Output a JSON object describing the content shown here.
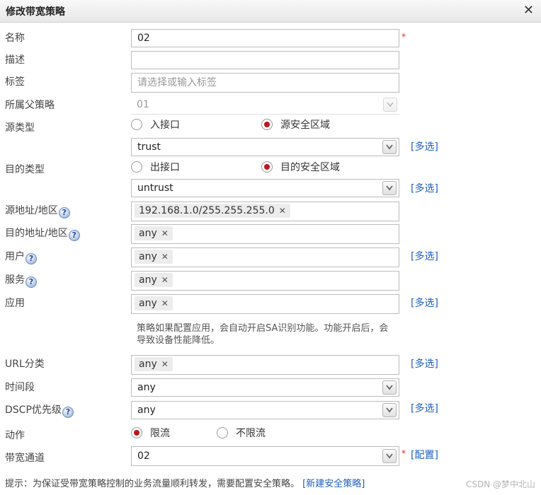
{
  "dialog": {
    "title": "修改带宽策略",
    "close_glyph": "✕"
  },
  "labels": {
    "name": "名称",
    "desc": "描述",
    "tag": "标签",
    "parent": "所属父策略",
    "src_type": "源类型",
    "dst_type": "目的类型",
    "src_addr": "源地址/地区",
    "dst_addr": "目的地址/地区",
    "user": "用户",
    "service": "服务",
    "app": "应用",
    "url": "URL分类",
    "schedule": "时间段",
    "dscp": "DSCP优先级",
    "action": "动作",
    "channel": "带宽通道"
  },
  "fields": {
    "name_value": "02",
    "desc_value": "",
    "tag_placeholder": "请选择或输入标签",
    "parent_value": "01",
    "src_zone_value": "trust",
    "dst_zone_value": "untrust",
    "src_addr_tag": "192.168.1.0/255.255.255.0",
    "dst_addr_tag": "any",
    "user_tag": "any",
    "service_tag": "any",
    "app_tag": "any",
    "url_tag": "any",
    "schedule_value": "any",
    "dscp_value": "any",
    "channel_value": "02"
  },
  "radios": {
    "src_in_if": "入接口",
    "src_zone": "源安全区域",
    "dst_out_if": "出接口",
    "dst_zone": "目的安全区域",
    "limit": "限流",
    "no_limit": "不限流"
  },
  "links": {
    "multi": "[多选]",
    "config": "[配置]",
    "new_policy": "[新建安全策略]"
  },
  "texts": {
    "required_mark": "*",
    "help_mark": "?",
    "tag_remove": "✕",
    "app_note": "策略如果配置应用，会自动开启SA识别功能。功能开启后，会导致设备性能降低。",
    "footer_tip": "提示：为保证受带宽策略控制的业务流量顺利转发，需要配置安全策略。",
    "watermark": "CSDN @梦中北山"
  },
  "colors": {
    "radio_selected": "#c0141b",
    "link": "#1f5fbf",
    "required": "#e23333"
  }
}
